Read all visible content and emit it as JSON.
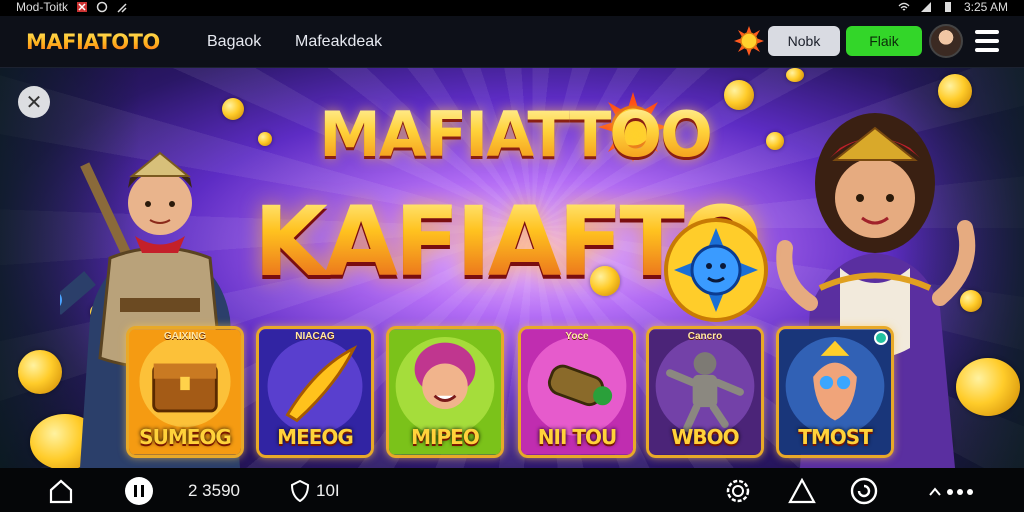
{
  "status_bar": {
    "left_text": "Mod-Toitk",
    "time": "3:25 AM"
  },
  "nav": {
    "logo": "MAFIATOTO",
    "links": [
      "Bagaok",
      "Mafeakdeak"
    ],
    "login_label": "Nobk",
    "register_label": "Flaik",
    "colors": {
      "register": "#33d629",
      "login": "#d9dbe2"
    }
  },
  "hero": {
    "title_line1": "MAFIATTOO",
    "title_line2": "KAFIAFTO",
    "close_icon": "tools-icon"
  },
  "games": [
    {
      "tag": "GAIXING",
      "name": "SUMEOG"
    },
    {
      "tag": "NIACAG",
      "name": "MEEOG"
    },
    {
      "tag": "",
      "name": "MIPEO"
    },
    {
      "tag": "Yoce",
      "name": "NII TOU"
    },
    {
      "tag": "Cancro",
      "name": "WBOO"
    },
    {
      "tag": "",
      "name": "TMOST"
    }
  ],
  "bottom_bar": {
    "balance": "2 3590",
    "shield_value": "10I"
  }
}
